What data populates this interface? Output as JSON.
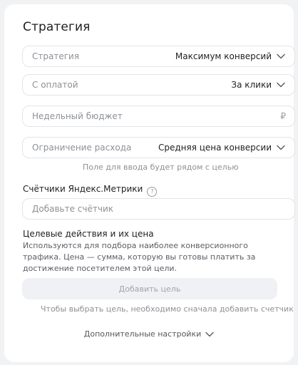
{
  "title": "Стратегия",
  "fields": {
    "strategy": {
      "label": "Стратегия",
      "value": "Максимум конверсий"
    },
    "payment": {
      "label": "С оплатой",
      "value": "За клики"
    },
    "budget": {
      "placeholder": "Недельный бюджет",
      "currency": "₽"
    },
    "limit": {
      "label": "Ограничение расхода",
      "value": "Средняя цена конверсии"
    }
  },
  "limit_hint": "Поле для ввода будет рядом с целью",
  "metrika": {
    "title": "Счётчики Яндекс.Метрики",
    "help": "?",
    "placeholder": "Добавьте счётчик"
  },
  "goals": {
    "title": "Целевые действия и их цена",
    "description": "Используются для подбора наиболее конверсионного трафика. Цена — сумма, которую вы готовы платить за достижение посетителем этой цели.",
    "add_button": "Добавить цель",
    "hint": "Чтобы выбрать цель, необходимо сначала добавить счетчик"
  },
  "more_settings": "Дополнительные настройки",
  "icons": [
    "chevron-down-icon",
    "help-icon",
    "ruble-icon"
  ]
}
